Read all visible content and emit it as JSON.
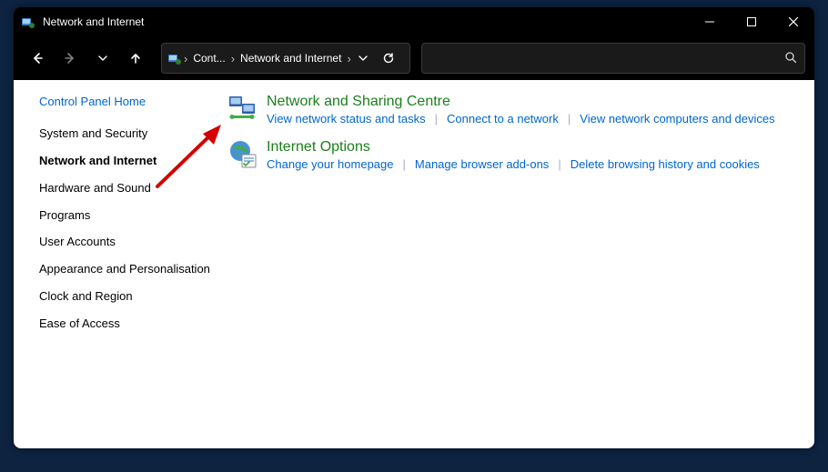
{
  "titlebar": {
    "title": "Network and Internet"
  },
  "breadcrumb": {
    "root_short": "Cont...",
    "current": "Network and Internet"
  },
  "sidebar": {
    "items": [
      {
        "label": "Control Panel Home",
        "active": false,
        "plain": false
      },
      {
        "label": "System and Security",
        "active": false,
        "plain": true
      },
      {
        "label": "Network and Internet",
        "active": true,
        "plain": true
      },
      {
        "label": "Hardware and Sound",
        "active": false,
        "plain": true
      },
      {
        "label": "Programs",
        "active": false,
        "plain": true
      },
      {
        "label": "User Accounts",
        "active": false,
        "plain": true
      },
      {
        "label": "Appearance and Personalisation",
        "active": false,
        "plain": true
      },
      {
        "label": "Clock and Region",
        "active": false,
        "plain": true
      },
      {
        "label": "Ease of Access",
        "active": false,
        "plain": true
      }
    ]
  },
  "main": {
    "cat1": {
      "title": "Network and Sharing Centre",
      "link1": "View network status and tasks",
      "link2": "Connect to a network",
      "link3": "View network computers and devices"
    },
    "cat2": {
      "title": "Internet Options",
      "link1": "Change your homepage",
      "link2": "Manage browser add-ons",
      "link3": "Delete browsing history and cookies"
    }
  }
}
